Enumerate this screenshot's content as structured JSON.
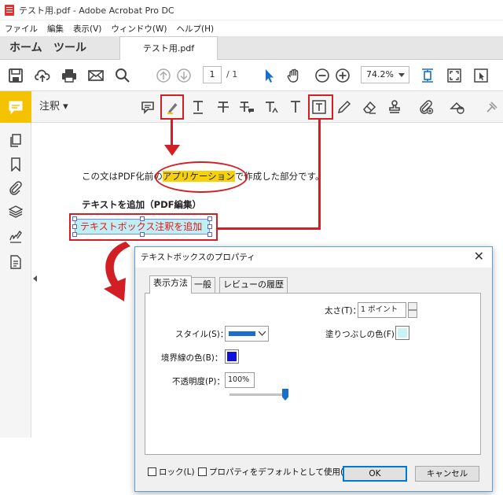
{
  "window": {
    "title": "テスト用.pdf - Adobe Acrobat Pro DC"
  },
  "menu": [
    "ファイル",
    "編集",
    "表示(V)",
    "ウィンドウ(W)",
    "ヘルプ(H)"
  ],
  "nav": {
    "home": "ホーム",
    "tools": "ツール",
    "doc_tab": "テスト用.pdf"
  },
  "toolbar": {
    "page_current": "1",
    "page_total": "/ 1",
    "zoom": "74.2%"
  },
  "comment_toolbar": {
    "label": "注釈 ▾"
  },
  "document": {
    "line1_before": "この文はPDF化前の",
    "line1_highlight": "アプリケーション",
    "line1_after": "で作成した部分です。",
    "heading": "テキストを追加（PDF編集）",
    "textbox": "テキストボックス注釈を追加"
  },
  "dialog": {
    "title": "テキストボックスのプロパティ",
    "close": "✕",
    "tabs": [
      "表示方法",
      "一般",
      "レビューの履歴"
    ],
    "thickness_label": "太さ(T)：",
    "thickness_value": "1 ポイント",
    "style_label": "スタイル(S)：",
    "fill_label": "塗りつぶしの色(F)：",
    "border_label": "境界線の色(B)：",
    "opacity_label": "不透明度(P)：",
    "opacity_value": "100%",
    "lock_label": "ロック(L)",
    "default_label": "プロパティをデフォルトとして使用(M)",
    "ok": "OK",
    "cancel": "キャンセル"
  },
  "colors": {
    "accent": "#f5c200",
    "annotation_red": "#d21f25",
    "border_color": "#1111dd",
    "fill_color": "#c9f3f5",
    "style_color": "#1a6fcc"
  },
  "opacity_fraction": 1.0
}
